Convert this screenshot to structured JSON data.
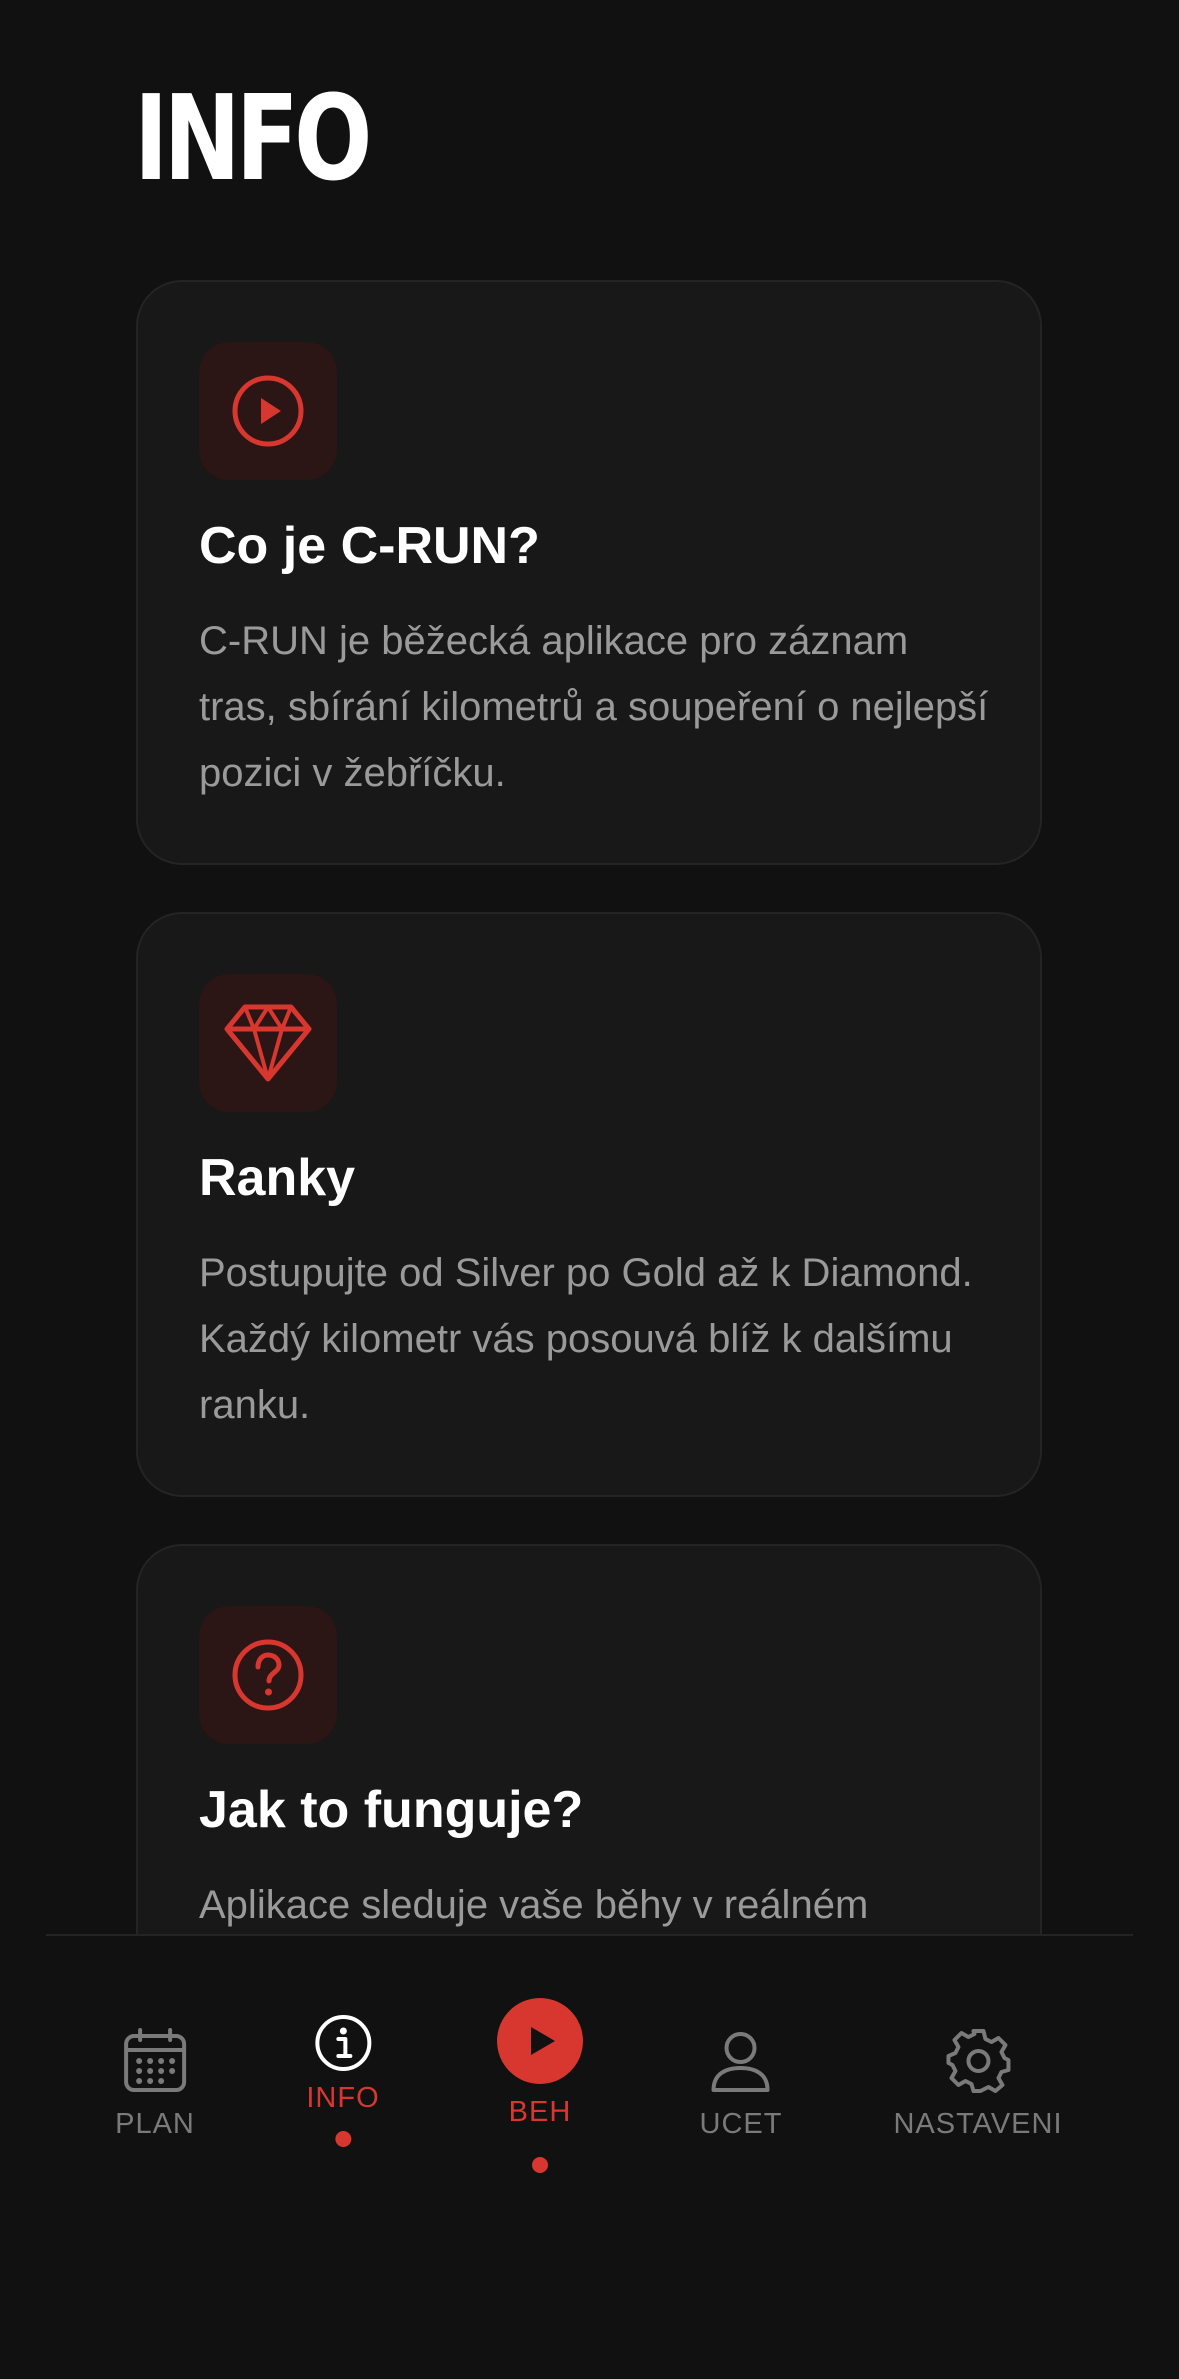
{
  "page": {
    "title": "INFO"
  },
  "colors": {
    "background": "#111111",
    "card_background": "#181818",
    "accent": "#d8372f",
    "icon_tile": "#2b1515",
    "muted_text": "#9a9a9a",
    "nav_inactive": "#7a7a7a"
  },
  "cards": [
    {
      "icon": "play-circle-icon",
      "title": "Co je C-RUN?",
      "text": "C-RUN je běžecká aplikace pro záznam tras, sbírání kilometrů a soupeření o nejlepší pozici v žebříčku."
    },
    {
      "icon": "diamond-icon",
      "title": "Ranky",
      "text": "Postupujte od Silver po Gold až k Diamond. Každý kilometr vás posouvá blíž k dalšímu ranku."
    },
    {
      "icon": "question-circle-icon",
      "title": "Jak to funguje?",
      "text": "Aplikace sleduje vaše běhy v reálném"
    }
  ],
  "nav": {
    "items": [
      {
        "label": "PLAN",
        "icon": "calendar-icon",
        "active": false
      },
      {
        "label": "INFO",
        "icon": "info-icon",
        "active": true
      },
      {
        "label": "BEH",
        "icon": "play-icon",
        "active": true
      },
      {
        "label": "UCET",
        "icon": "user-icon",
        "active": false
      },
      {
        "label": "NASTAVENI",
        "icon": "gear-icon",
        "active": false
      }
    ]
  }
}
